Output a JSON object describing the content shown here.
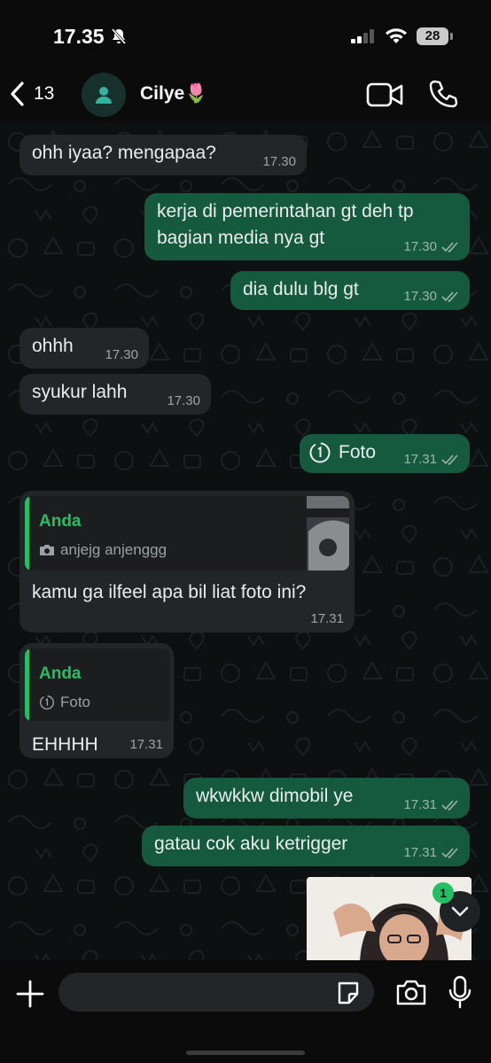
{
  "status_bar": {
    "time": "17.35",
    "battery": "28"
  },
  "header": {
    "back_count": "13",
    "contact_name": "Cilye🌷"
  },
  "messages": [
    {
      "dir": "in",
      "text": "ohh iyaa? mengapaa?",
      "time": "17.30"
    },
    {
      "dir": "out",
      "text": "kerja di pemerintahan gt deh tp bagian media nya gt",
      "time": "17.30"
    },
    {
      "dir": "out",
      "text": "dia dulu blg gt",
      "time": "17.30"
    },
    {
      "dir": "in",
      "text": "ohhh",
      "time": "17.30"
    },
    {
      "dir": "in",
      "text": "syukur lahh",
      "time": "17.30"
    },
    {
      "dir": "out",
      "text": "Foto",
      "time": "17.31"
    },
    {
      "dir": "in",
      "reply_to": {
        "author": "Anda",
        "preview": "anjejg anjenggg"
      },
      "text": "kamu ga ilfeel apa bil liat foto ini?",
      "time": "17.31"
    },
    {
      "dir": "in",
      "reply_to": {
        "author": "Anda",
        "preview": "Foto"
      },
      "text": "EHHHH",
      "time": "17.31"
    },
    {
      "dir": "out",
      "text": "wkwkkw dimobil ye",
      "time": "17.31"
    },
    {
      "dir": "out",
      "text": "gatau cok aku ketrigger",
      "time": "17.31"
    }
  ],
  "unread_badge": "1",
  "colors": {
    "outgoing": "#155a3e",
    "incoming": "#232628",
    "accent": "#21c063"
  },
  "icons": [
    "bell-off-icon",
    "signal-icon",
    "wifi-icon",
    "back-icon",
    "person-icon",
    "video-icon",
    "phone-icon",
    "double-check-icon",
    "view-once-icon",
    "camera-icon",
    "plus-icon",
    "sticker-icon",
    "mic-icon",
    "chevron-down-icon"
  ]
}
